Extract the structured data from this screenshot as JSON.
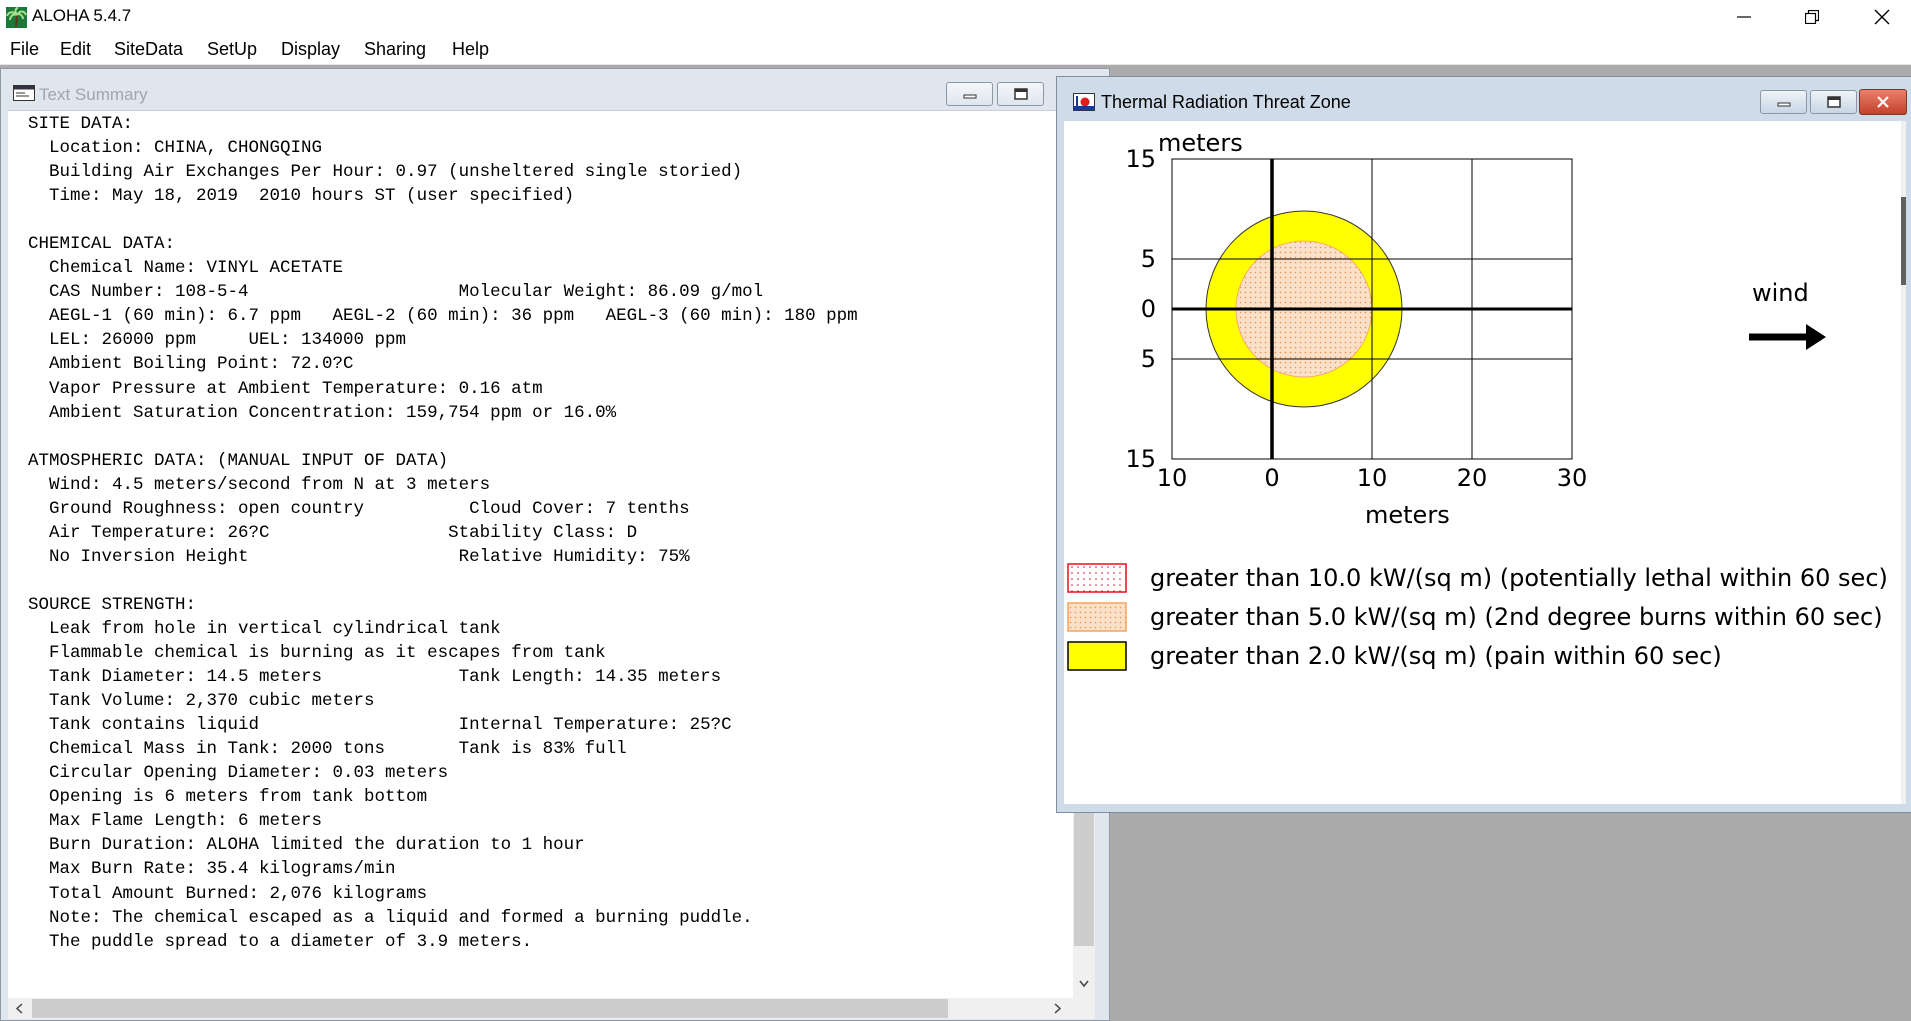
{
  "app": {
    "title": "ALOHA 5.4.7",
    "menu": [
      "File",
      "Edit",
      "SiteData",
      "SetUp",
      "Display",
      "Sharing",
      "Help"
    ]
  },
  "text_summary": {
    "title": "Text Summary",
    "lines": [
      "SITE DATA:",
      "  Location: CHINA, CHONGQING",
      "  Building Air Exchanges Per Hour: 0.97 (unsheltered single storied)",
      "  Time: May 18, 2019  2010 hours ST (user specified)",
      "",
      "CHEMICAL DATA:",
      "  Chemical Name: VINYL ACETATE",
      "  CAS Number: 108-5-4                    Molecular Weight: 86.09 g/mol",
      "  AEGL-1 (60 min): 6.7 ppm   AEGL-2 (60 min): 36 ppm   AEGL-3 (60 min): 180 ppm",
      "  LEL: 26000 ppm     UEL: 134000 ppm",
      "  Ambient Boiling Point: 72.0?C",
      "  Vapor Pressure at Ambient Temperature: 0.16 atm",
      "  Ambient Saturation Concentration: 159,754 ppm or 16.0%",
      "",
      "ATMOSPHERIC DATA: (MANUAL INPUT OF DATA)",
      "  Wind: 4.5 meters/second from N at 3 meters",
      "  Ground Roughness: open country          Cloud Cover: 7 tenths",
      "  Air Temperature: 26?C                 Stability Class: D",
      "  No Inversion Height                    Relative Humidity: 75%",
      "",
      "SOURCE STRENGTH:",
      "  Leak from hole in vertical cylindrical tank",
      "  Flammable chemical is burning as it escapes from tank",
      "  Tank Diameter: 14.5 meters             Tank Length: 14.35 meters",
      "  Tank Volume: 2,370 cubic meters",
      "  Tank contains liquid                   Internal Temperature: 25?C",
      "  Chemical Mass in Tank: 2000 tons       Tank is 83% full",
      "  Circular Opening Diameter: 0.03 meters",
      "  Opening is 6 meters from tank bottom",
      "  Max Flame Length: 6 meters",
      "  Burn Duration: ALOHA limited the duration to 1 hour",
      "  Max Burn Rate: 35.4 kilograms/min",
      "  Total Amount Burned: 2,076 kilograms",
      "  Note: The chemical escaped as a liquid and formed a burning puddle.",
      "  The puddle spread to a diameter of 3.9 meters."
    ]
  },
  "threat_zone": {
    "title": "Thermal Radiation Threat Zone",
    "y_axis_label": "meters",
    "x_axis_label": "meters",
    "y_ticks": [
      "15",
      "5",
      "0",
      "5",
      "15"
    ],
    "x_ticks": [
      "10",
      "0",
      "10",
      "20",
      "30"
    ],
    "wind_label": "wind",
    "legend": [
      {
        "label": "greater than 10.0 kW/(sq m) (potentially lethal within 60 sec)",
        "color": "#e8101c",
        "pattern": "dots-red"
      },
      {
        "label": "greater than 5.0 kW/(sq m) (2nd degree burns within 60 sec)",
        "color": "#f7a35c",
        "pattern": "dots-orange"
      },
      {
        "label": "greater than 2.0 kW/(sq m) (pain within 60 sec)",
        "color": "#ffff00",
        "pattern": "solid-yellow"
      }
    ]
  },
  "chart_data": {
    "type": "threat-zone-plot",
    "title": "Thermal Radiation Threat Zone",
    "xlabel": "meters",
    "ylabel": "meters",
    "xlim": [
      -10,
      30
    ],
    "ylim": [
      -15,
      15
    ],
    "zones": [
      {
        "name": "greater than 10.0 kW/(sq m) (potentially lethal within 60 sec)",
        "radius": 0
      },
      {
        "name": "greater than 5.0 kW/(sq m) (2nd degree burns within 60 sec)",
        "center_x": 3.2,
        "radius": 6.8
      },
      {
        "name": "greater than 2.0 kW/(sq m) (pain within 60 sec)",
        "center_x": 3.2,
        "radius": 9.8
      }
    ],
    "wind_direction": "toward +x"
  },
  "colors": {
    "zone_outer": "#ffff00",
    "zone_inner": "#f9dcc1",
    "zone_inner_dots": "#e8a070",
    "close_button": "#c4412b"
  }
}
